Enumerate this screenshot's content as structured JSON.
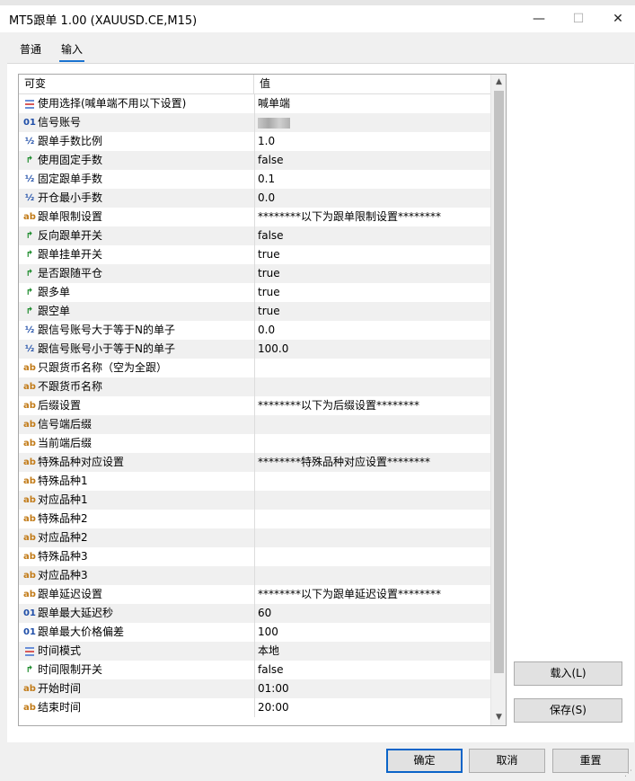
{
  "window": {
    "title": "MT5跟单 1.00 (XAUUSD.CE,M15)",
    "min_glyph": "—",
    "max_glyph": "☐",
    "close_glyph": "✕"
  },
  "tabs": [
    {
      "label": "普通"
    },
    {
      "label": "输入"
    }
  ],
  "grid": {
    "col_name": "可变",
    "col_value": "值",
    "rows": [
      {
        "type": "enum",
        "name": "使用选择(喊单端不用以下设置)",
        "value": "喊单端"
      },
      {
        "type": "int",
        "name": "信号账号",
        "value": ""
      },
      {
        "type": "double",
        "name": "跟单手数比例",
        "value": "1.0"
      },
      {
        "type": "bool",
        "name": "使用固定手数",
        "value": "false"
      },
      {
        "type": "double",
        "name": "固定跟单手数",
        "value": "0.1"
      },
      {
        "type": "double",
        "name": "开仓最小手数",
        "value": "0.0"
      },
      {
        "type": "string",
        "name": "跟单限制设置",
        "value": "********以下为跟单限制设置********"
      },
      {
        "type": "bool",
        "name": "反向跟单开关",
        "value": "false"
      },
      {
        "type": "bool",
        "name": "跟单挂单开关",
        "value": "true"
      },
      {
        "type": "bool",
        "name": "是否跟随平仓",
        "value": "true"
      },
      {
        "type": "bool",
        "name": "跟多单",
        "value": "true"
      },
      {
        "type": "bool",
        "name": "跟空单",
        "value": "true"
      },
      {
        "type": "double",
        "name": "跟信号账号大于等于N的单子",
        "value": "0.0"
      },
      {
        "type": "double",
        "name": "跟信号账号小于等于N的单子",
        "value": "100.0"
      },
      {
        "type": "string",
        "name": "只跟货币名称（空为全跟）",
        "value": ""
      },
      {
        "type": "string",
        "name": "不跟货币名称",
        "value": ""
      },
      {
        "type": "string",
        "name": "后缀设置",
        "value": "********以下为后缀设置********"
      },
      {
        "type": "string",
        "name": "信号端后缀",
        "value": ""
      },
      {
        "type": "string",
        "name": "当前端后缀",
        "value": ""
      },
      {
        "type": "string",
        "name": "特殊品种对应设置",
        "value": "********特殊品种对应设置********"
      },
      {
        "type": "string",
        "name": "特殊品种1",
        "value": ""
      },
      {
        "type": "string",
        "name": "对应品种1",
        "value": ""
      },
      {
        "type": "string",
        "name": "特殊品种2",
        "value": ""
      },
      {
        "type": "string",
        "name": "对应品种2",
        "value": ""
      },
      {
        "type": "string",
        "name": "特殊品种3",
        "value": ""
      },
      {
        "type": "string",
        "name": "对应品种3",
        "value": ""
      },
      {
        "type": "string",
        "name": "跟单延迟设置",
        "value": "********以下为跟单延迟设置********"
      },
      {
        "type": "int",
        "name": "跟单最大延迟秒",
        "value": "60"
      },
      {
        "type": "int",
        "name": "跟单最大价格偏差",
        "value": "100"
      },
      {
        "type": "enum",
        "name": "时间模式",
        "value": "本地"
      },
      {
        "type": "bool",
        "name": "时间限制开关",
        "value": "false"
      },
      {
        "type": "string",
        "name": "开始时间",
        "value": "01:00"
      },
      {
        "type": "string",
        "name": "结束时间",
        "value": "20:00"
      }
    ]
  },
  "icons": {
    "string": {
      "glyph": "ab",
      "name": "string-type-icon"
    },
    "int": {
      "glyph": "01",
      "name": "integer-type-icon"
    },
    "double": {
      "glyph": "½",
      "name": "double-type-icon"
    },
    "bool": {
      "glyph": "↱",
      "name": "bool-type-icon"
    },
    "enum": {
      "glyph": "",
      "name": "enum-type-icon"
    }
  },
  "buttons": {
    "load": "载入(L)",
    "save": "保存(S)",
    "ok": "确定",
    "cancel": "取消",
    "reset": "重置"
  },
  "scroll": {
    "up": "▲",
    "down": "▼"
  },
  "colors": {
    "accent": "#0a64c8",
    "tab_underline": "#1a73d0",
    "string_icon": "#c27b18",
    "bool_icon": "#1a8a2a",
    "number_icon": "#1f4ea8"
  }
}
